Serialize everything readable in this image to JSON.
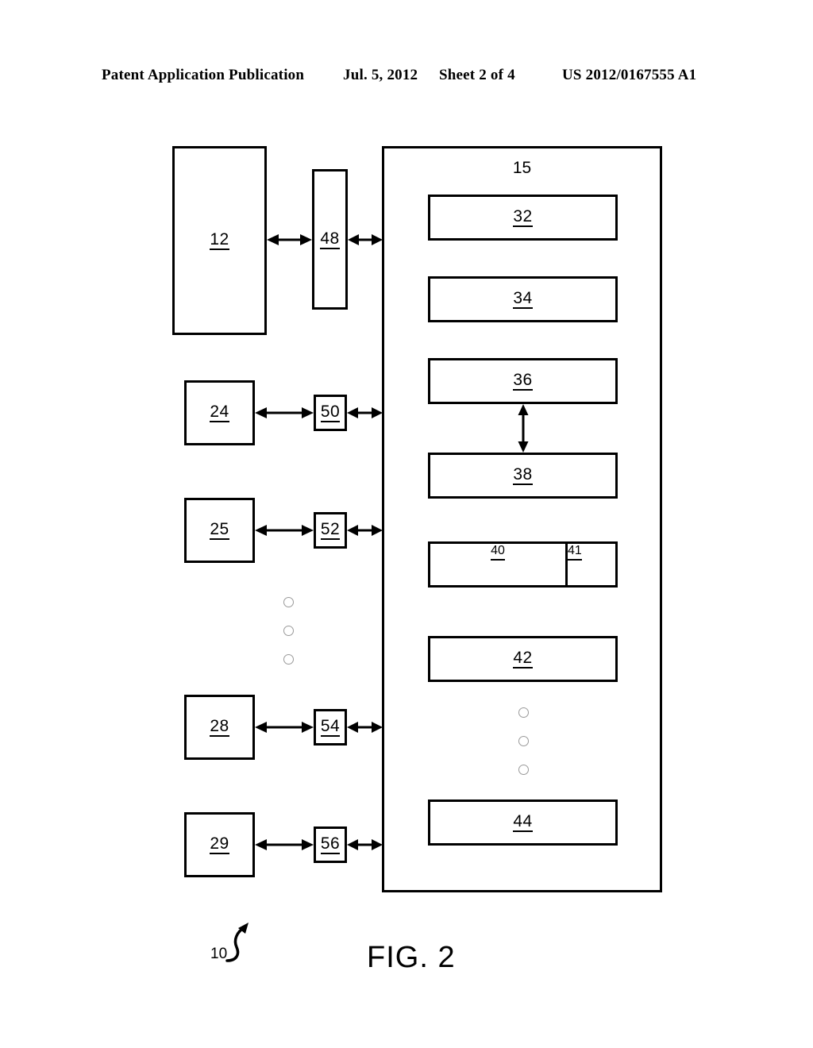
{
  "header": {
    "publication": "Patent Application Publication",
    "date": "Jul. 5, 2012",
    "sheet": "Sheet 2 of 4",
    "patent_number": "US 2012/0167555 A1"
  },
  "figure": {
    "caption": "FIG. 2",
    "system_reference": "10"
  },
  "diagram": {
    "container_label": "15",
    "left_column": [
      {
        "id": "box-12",
        "label": "12"
      },
      {
        "id": "box-24",
        "label": "24"
      },
      {
        "id": "box-25",
        "label": "25"
      },
      {
        "id": "box-28",
        "label": "28"
      },
      {
        "id": "box-29",
        "label": "29"
      }
    ],
    "middle_column": [
      {
        "id": "box-48",
        "label": "48"
      },
      {
        "id": "box-50",
        "label": "50"
      },
      {
        "id": "box-52",
        "label": "52"
      },
      {
        "id": "box-54",
        "label": "54"
      },
      {
        "id": "box-56",
        "label": "56"
      }
    ],
    "inner_blocks": [
      {
        "id": "box-32",
        "label": "32"
      },
      {
        "id": "box-34",
        "label": "34"
      },
      {
        "id": "box-36",
        "label": "36"
      },
      {
        "id": "box-38",
        "label": "38"
      },
      {
        "id": "box-40",
        "label": "40"
      },
      {
        "id": "box-41",
        "label": "41"
      },
      {
        "id": "box-42",
        "label": "42"
      },
      {
        "id": "box-44",
        "label": "44"
      }
    ],
    "ellipsis_groups": [
      {
        "id": "left-ellipsis",
        "count": 3
      },
      {
        "id": "inner-ellipsis",
        "count": 3
      }
    ],
    "connectors": [
      {
        "id": "conn-12-48",
        "type": "bidirectional-horizontal"
      },
      {
        "id": "conn-48-15",
        "type": "bidirectional-horizontal"
      },
      {
        "id": "conn-24-50",
        "type": "bidirectional-horizontal"
      },
      {
        "id": "conn-50-15",
        "type": "bidirectional-horizontal"
      },
      {
        "id": "conn-25-52",
        "type": "bidirectional-horizontal"
      },
      {
        "id": "conn-52-15",
        "type": "bidirectional-horizontal"
      },
      {
        "id": "conn-28-54",
        "type": "bidirectional-horizontal"
      },
      {
        "id": "conn-54-15",
        "type": "bidirectional-horizontal"
      },
      {
        "id": "conn-29-56",
        "type": "bidirectional-horizontal"
      },
      {
        "id": "conn-56-15",
        "type": "bidirectional-horizontal"
      },
      {
        "id": "conn-36-38",
        "type": "bidirectional-vertical"
      }
    ]
  },
  "colors": {
    "ink": "#000000",
    "paper": "#ffffff",
    "ellipsis_outline": "#999999"
  }
}
